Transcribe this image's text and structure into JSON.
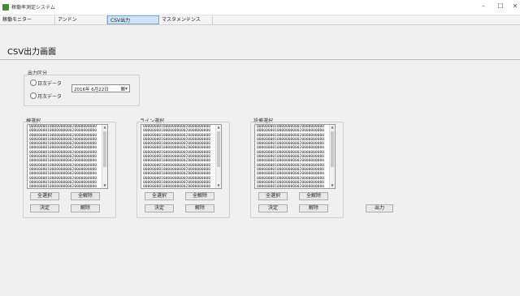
{
  "window": {
    "title": "稼働率測定システム",
    "minimize_glyph": "–",
    "maximize_glyph": "☐",
    "close_glyph": "✕"
  },
  "menu": {
    "tabs": [
      {
        "label": "稼働モニター"
      },
      {
        "label": "アンドン"
      },
      {
        "label": "CSV出力"
      },
      {
        "label": "マスタメンテンス"
      }
    ],
    "active_index": 2
  },
  "screen": {
    "title": "CSV出力画面"
  },
  "output_section": {
    "label": "出力区分",
    "radio_daily": "日次データ",
    "radio_monthly": "月次データ",
    "date_value": "2016年 6月22日",
    "calendar_icon": "calendar-dropdown-icon"
  },
  "lists": [
    {
      "label": "棟選択",
      "items": [
        "000000001000000000020000000000",
        "000000001000000000020000000000",
        "000000001000000000020000000000",
        "000000001000000000020000000000",
        "000000001000000000020000000000",
        "000000001000000000020000000000",
        "000000001000000000020000000000",
        "000000001000000000020000000000",
        "000000001000000000020000000000",
        "000000001000000000020000000000",
        "000000001000000000020000000000",
        "000000001000000000020000000000",
        "000000001000000000020000000000",
        "000000001000000000020000000000",
        "000000001000000000020000000000"
      ],
      "select_all": "全選択",
      "deselect_all": "全解除",
      "confirm": "決定",
      "release": "解除"
    },
    {
      "label": "ライン選択",
      "items": [
        "000000001000000000020000000000",
        "000000001000000000020000000000",
        "000000001000000000020000000000",
        "000000001000000000020000000000",
        "000000001000000000020000000000",
        "000000001000000000020000000000",
        "000000001000000000020000000000",
        "000000001000000000020000000000",
        "000000001000000000020000000000",
        "000000001000000000020000000000",
        "000000001000000000020000000000",
        "000000001000000000020000000000",
        "000000001000000000020000000000",
        "000000001000000000020000000000",
        "000000001000000000020000000000"
      ],
      "select_all": "全選択",
      "deselect_all": "全解除",
      "confirm": "決定",
      "release": "解除"
    },
    {
      "label": "設備選択",
      "items": [
        "000000001000000000020000000000",
        "000000001000000000020000000000",
        "000000001000000000020000000000",
        "000000001000000000020000000000",
        "000000001000000000020000000000",
        "000000001000000000020000000000",
        "000000001000000000020000000000",
        "000000001000000000020000000000",
        "000000001000000000020000000000",
        "000000001000000000020000000000",
        "000000001000000000020000000000",
        "000000001000000000020000000000",
        "000000001000000000020000000000",
        "000000001000000000020000000000",
        "000000001000000000020000000000"
      ],
      "select_all": "全選択",
      "deselect_all": "全解除",
      "confirm": "決定",
      "release": "解除"
    }
  ],
  "output_button": "出力"
}
